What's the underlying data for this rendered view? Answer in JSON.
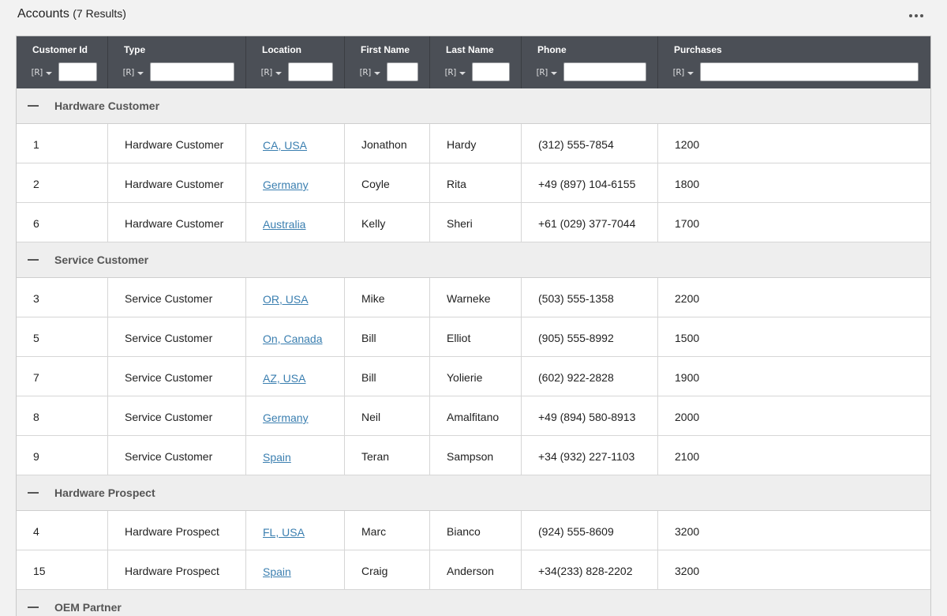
{
  "header": {
    "title": "Accounts",
    "result_count": "(7 Results)",
    "more_icon": "more-horizontal-icon"
  },
  "filter_icon": "[R]",
  "columns": [
    {
      "label": "Customer Id"
    },
    {
      "label": "Type"
    },
    {
      "label": "Location"
    },
    {
      "label": "First Name"
    },
    {
      "label": "Last Name"
    },
    {
      "label": "Phone"
    },
    {
      "label": "Purchases"
    }
  ],
  "groups": [
    {
      "label": "Hardware Customer",
      "rows": [
        {
          "id": "1",
          "type": "Hardware Customer",
          "location": "CA, USA",
          "first": "Jonathon",
          "last": "Hardy",
          "phone": "(312) 555-7854",
          "purchases": "1200"
        },
        {
          "id": "2",
          "type": "Hardware Customer",
          "location": "Germany",
          "first": "Coyle",
          "last": "Rita",
          "phone": "+49 (897) 104-6155",
          "purchases": "1800"
        },
        {
          "id": "6",
          "type": "Hardware Customer",
          "location": "Australia",
          "first": "Kelly",
          "last": "Sheri",
          "phone": "+61 (029) 377-7044",
          "purchases": "1700"
        }
      ]
    },
    {
      "label": "Service Customer",
      "rows": [
        {
          "id": "3",
          "type": "Service Customer",
          "location": "OR, USA",
          "first": "Mike",
          "last": "Warneke",
          "phone": "(503) 555-1358",
          "purchases": "2200"
        },
        {
          "id": "5",
          "type": "Service Customer",
          "location": "On, Canada",
          "first": "Bill",
          "last": "Elliot",
          "phone": "(905) 555-8992",
          "purchases": "1500"
        },
        {
          "id": "7",
          "type": "Service Customer",
          "location": "AZ, USA",
          "first": "Bill",
          "last": "Yolierie",
          "phone": "(602) 922-2828",
          "purchases": "1900"
        },
        {
          "id": "8",
          "type": "Service Customer",
          "location": "Germany",
          "first": "Neil",
          "last": "Amalfitano",
          "phone": "+49 (894) 580-8913",
          "purchases": "2000"
        },
        {
          "id": "9",
          "type": "Service Customer",
          "location": "Spain",
          "first": "Teran",
          "last": "Sampson",
          "phone": "+34 (932) 227-1103",
          "purchases": "2100"
        }
      ]
    },
    {
      "label": "Hardware Prospect",
      "rows": [
        {
          "id": "4",
          "type": "Hardware Prospect",
          "location": "FL, USA",
          "first": "Marc",
          "last": "Bianco",
          "phone": "(924) 555-8609",
          "purchases": "3200"
        },
        {
          "id": "15",
          "type": "Hardware Prospect",
          "location": "Spain",
          "first": "Craig",
          "last": "Anderson",
          "phone": "+34(233) 828-2202",
          "purchases": "3200"
        }
      ]
    },
    {
      "label": "OEM Partner",
      "rows": []
    }
  ]
}
